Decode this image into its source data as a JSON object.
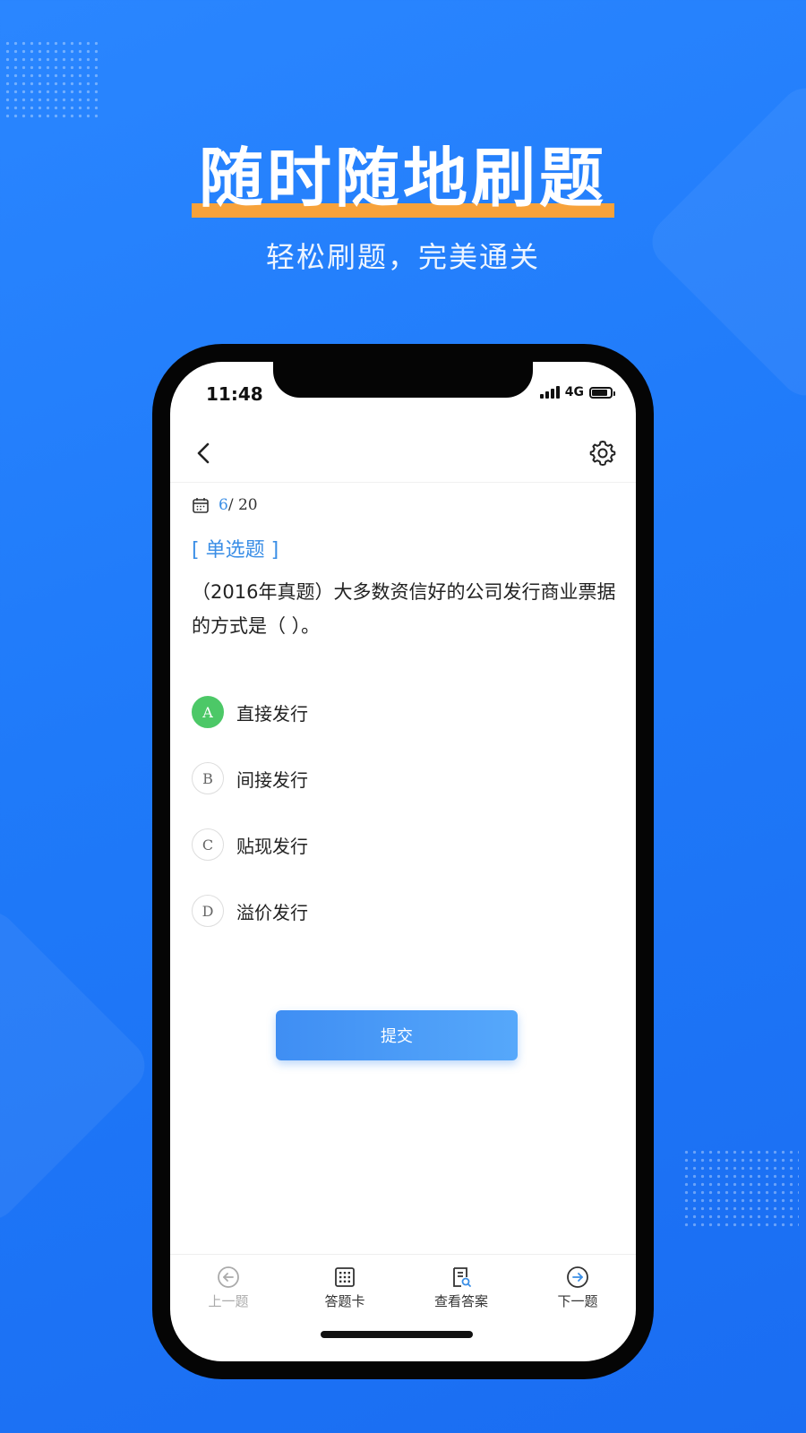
{
  "promo": {
    "headline": "随时随地刷题",
    "subtitle": "轻松刷题，完美通关",
    "accent_color": "#f7a23a",
    "background_color": "#2a86ff"
  },
  "status_bar": {
    "time": "11:48",
    "network": "4G"
  },
  "nav": {
    "back_icon": "chevron-left-icon",
    "settings_icon": "gear-icon"
  },
  "progress": {
    "current": "6",
    "total": "/ 20"
  },
  "question": {
    "type_label": "[ 单选题 ]",
    "text": "（2016年真题）大多数资信好的公司发行商业票据的方式是（ ）。",
    "selected": "A",
    "options": [
      {
        "letter": "A",
        "text": "直接发行"
      },
      {
        "letter": "B",
        "text": "间接发行"
      },
      {
        "letter": "C",
        "text": "贴现发行"
      },
      {
        "letter": "D",
        "text": "溢价发行"
      }
    ]
  },
  "submit_label": "提交",
  "tabbar": {
    "prev": "上一题",
    "answer_card": "答题卡",
    "view_answer": "查看答案",
    "next": "下一题"
  }
}
